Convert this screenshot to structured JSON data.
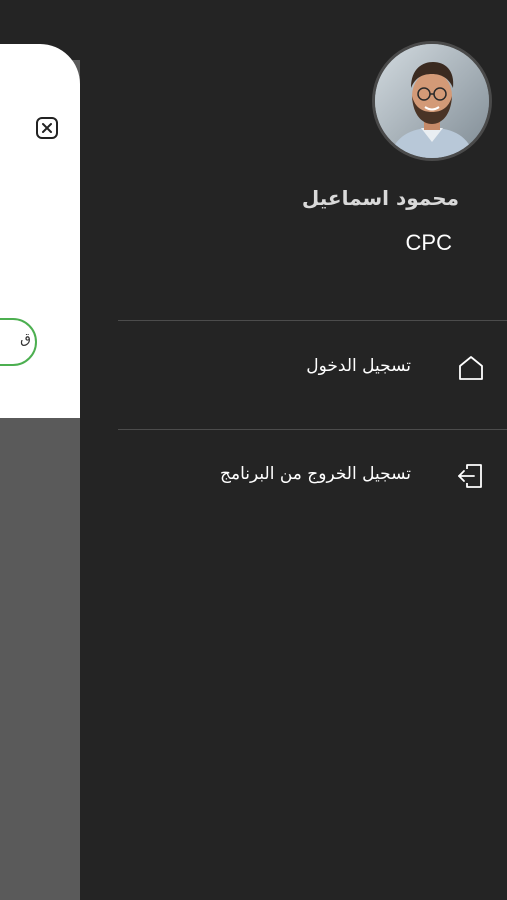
{
  "background_page": {
    "close_icon": "close-icon",
    "pill_text": "ق"
  },
  "drawer": {
    "profile": {
      "avatar_alt": "avatar",
      "name": "محمود اسماعيل",
      "role": "CPC"
    },
    "menu": [
      {
        "label": "تسجيل الدخول",
        "icon": "home-icon"
      },
      {
        "label": "تسجيل الخروج من البرنامج",
        "icon": "logout-icon"
      }
    ]
  },
  "colors": {
    "drawer_bg": "#242424",
    "divider": "#4c4c4c",
    "accent_green": "#4caf50",
    "overlay": "#5a5a5a"
  }
}
